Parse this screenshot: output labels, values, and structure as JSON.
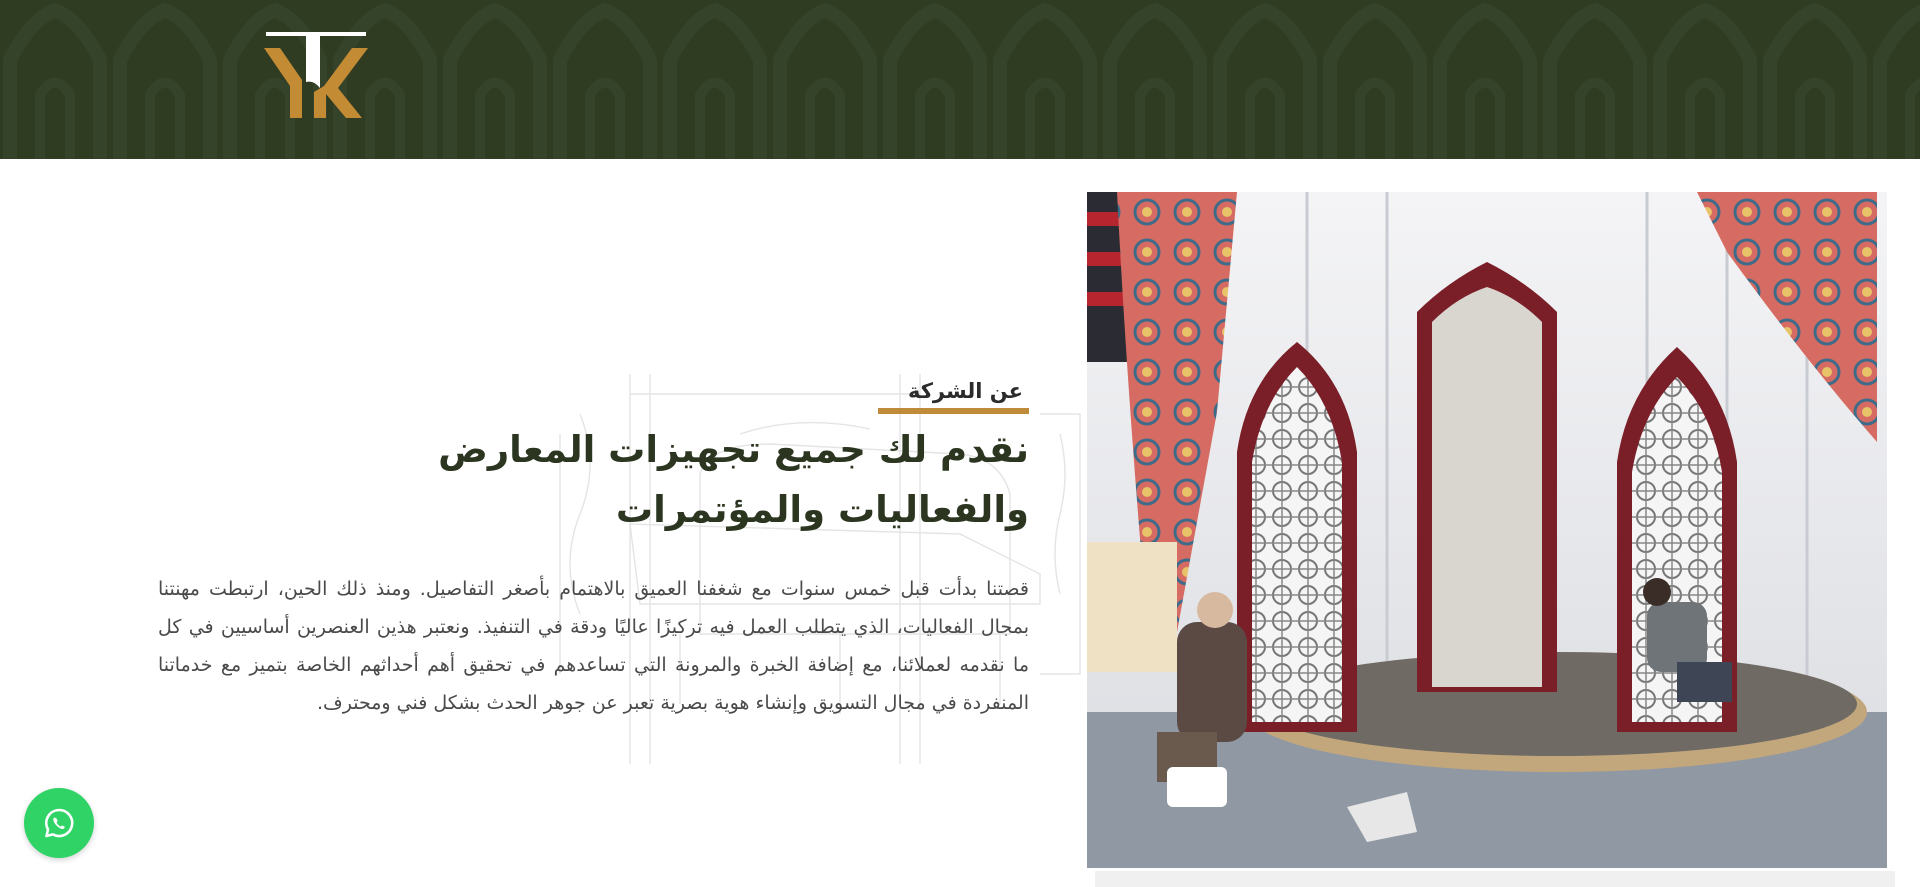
{
  "brand": {
    "logo_alt": "TK",
    "colors": {
      "header_bg": "#2f3c22",
      "accent_gold": "#bf8a39",
      "heading_green": "#2b3520",
      "whatsapp_green": "#2fd366"
    }
  },
  "about": {
    "eyebrow": "عن الشركة",
    "headline": "نقدم لك جميع تجهيزات المعارض والفعاليات والمؤتمرات",
    "paragraph": "قصتنا بدأت قبل خمس سنوات مع شغفنا العميق بالاهتمام بأصغر التفاصيل. ومنذ ذلك الحين، ارتبطت مهنتنا بمجال الفعاليات، الذي يتطلب العمل فيه تركيزًا عاليًا ودقة في التنفيذ. ونعتبر هذين العنصرين أساسيين في كل ما نقدمه لعملائنا، مع إضافة الخبرة والمرونة التي تساعدهم في تحقيق أهم أحداثهم الخاصة بتميز مع خدماتنا المنفردة في مجال التسويق وإنشاء هوية بصرية تعبر عن جوهر الحدث بشكل فني ومحترف."
  },
  "floating": {
    "whatsapp_icon": "whatsapp-icon"
  }
}
